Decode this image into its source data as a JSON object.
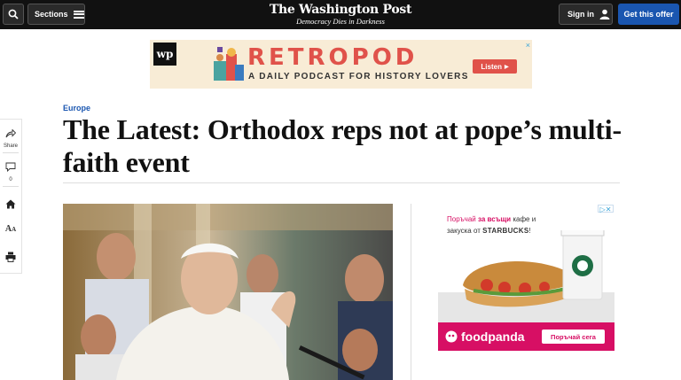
{
  "header": {
    "sections_label": "Sections",
    "logo_name": "The Washington Post",
    "logo_tagline": "Democracy Dies in Darkness",
    "signin_label": "Sign in",
    "offer_label": "Get this offer"
  },
  "banner_ad": {
    "badge": "wp",
    "title": "RETROPOD",
    "subtitle": "A DAILY PODCAST FOR HISTORY LOVERS",
    "cta": "Listen",
    "close": "×"
  },
  "share_rail": {
    "share_label": "Share",
    "comments_count": "0"
  },
  "article": {
    "kicker": "Europe",
    "headline": "The Latest: Orthodox reps not at pope’s multi-faith event"
  },
  "side_ad": {
    "line1_pink": "Поръчай",
    "line1_pink2": "за всъщи",
    "line1_rest": "кафе и",
    "line2_prefix": "закуска от",
    "brand": "STARBUCKS",
    "exclaim": "!",
    "foodpanda": "foodpanda",
    "cta": "Поръчай сега",
    "adchoice": "▷✕"
  },
  "colors": {
    "accent_blue": "#1a56b0",
    "retropod_red": "#e0524a",
    "foodpanda_pink": "#d70f64"
  },
  "icons": [
    "search-icon",
    "menu-icon",
    "user-icon",
    "share-icon",
    "comment-icon",
    "home-icon",
    "text-size-icon",
    "print-icon"
  ]
}
